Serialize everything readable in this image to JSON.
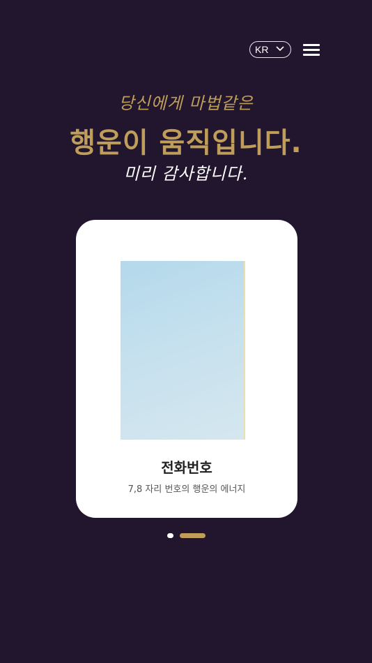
{
  "header": {
    "language": "KR",
    "icons": {
      "language_dropdown": "chevron-down-icon",
      "menu": "hamburger-menu-icon"
    }
  },
  "hero": {
    "line1": "당신에게 마법같은",
    "line2": "행운이 움직입니다.",
    "line3": "미리 감사합니다."
  },
  "card": {
    "title": "전화번호",
    "subtitle": "7,8 자리 번호의 행운의 에너지"
  },
  "carousel": {
    "slide_count": 2,
    "active_index": 1
  },
  "colors": {
    "background": "#21162d",
    "accent_gold": "#bf9d5a",
    "card": "#ffffff",
    "image_blue": "#c5e0ee"
  }
}
